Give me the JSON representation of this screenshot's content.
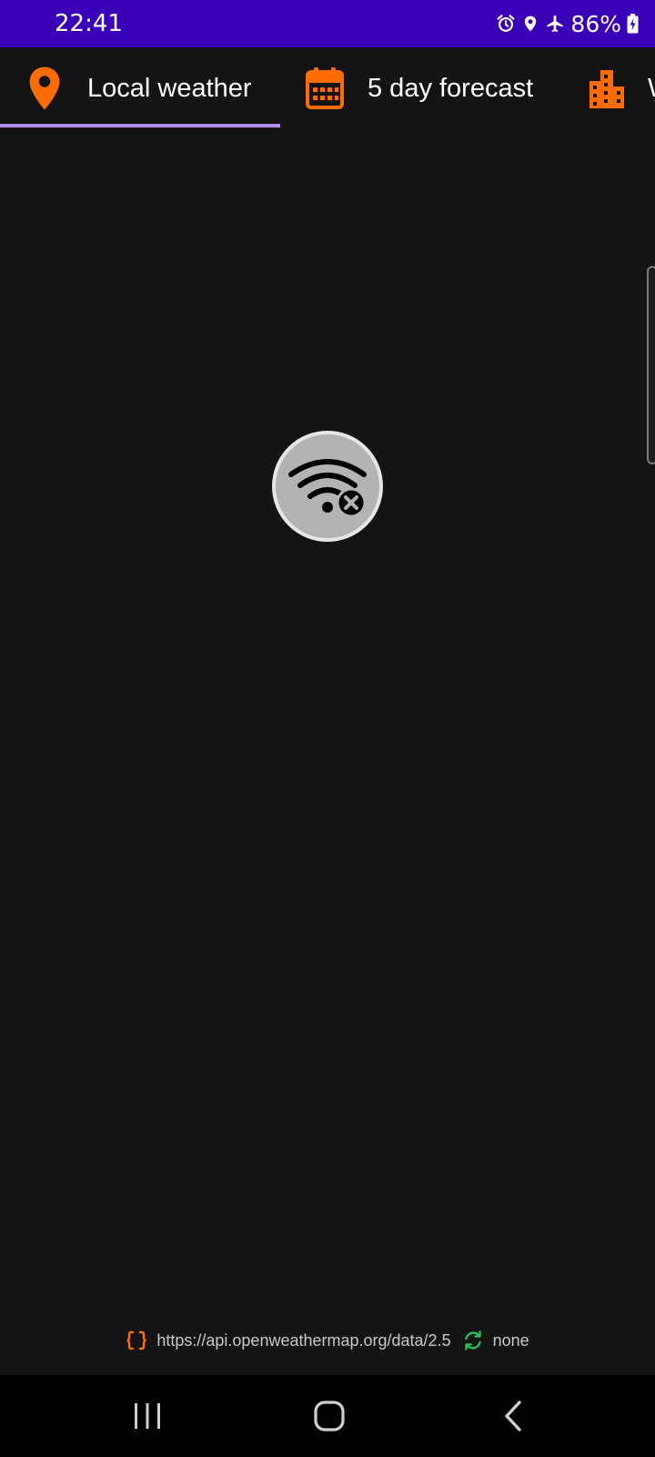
{
  "status_bar": {
    "time": "22:41",
    "battery": "86%",
    "icons": [
      "alarm-icon",
      "location-icon",
      "airplane-mode-icon",
      "battery-charging-icon"
    ]
  },
  "tabs": [
    {
      "label": "Local weather",
      "icon": "map-pin-icon",
      "selected": true
    },
    {
      "label": "5 day forecast",
      "icon": "calendar-icon",
      "selected": false
    },
    {
      "label": "W",
      "icon": "city-buildings-icon",
      "selected": false
    }
  ],
  "main": {
    "status_icon": "wifi-off-icon"
  },
  "footer": {
    "api_icon": "braces-icon",
    "api_url": "https://api.openweathermap.org/data/2.5",
    "refresh_icon": "refresh-icon",
    "refresh_value": "none"
  },
  "colors": {
    "status_bar": "#3a00b8",
    "accent": "#ff6d00",
    "tab_indicator": "#b48ef5",
    "background": "#141414",
    "refresh_icon": "#2ebd5f"
  }
}
